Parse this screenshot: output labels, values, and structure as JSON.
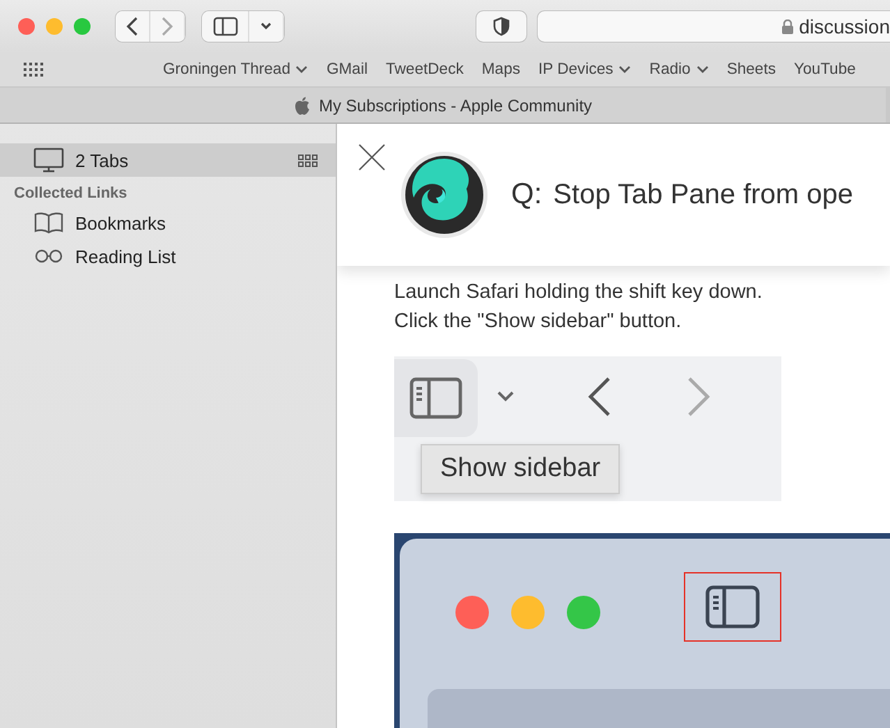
{
  "toolbar": {
    "address": "discussion"
  },
  "bookmarks": [
    {
      "label": "Groningen Thread",
      "menu": true
    },
    {
      "label": "GMail",
      "menu": false
    },
    {
      "label": "TweetDeck",
      "menu": false
    },
    {
      "label": "Maps",
      "menu": false
    },
    {
      "label": "IP Devices",
      "menu": true
    },
    {
      "label": "Radio",
      "menu": true
    },
    {
      "label": "Sheets",
      "menu": false
    },
    {
      "label": "YouTube",
      "menu": false
    }
  ],
  "tab": {
    "title": "My Subscriptions - Apple Community"
  },
  "sidebar": {
    "tabs_item": {
      "label": "2 Tabs",
      "selected": true
    },
    "section": "Collected Links",
    "items": [
      {
        "kind": "book",
        "label": "Bookmarks"
      },
      {
        "kind": "glasses",
        "label": "Reading List"
      }
    ]
  },
  "question": {
    "prefix": "Q:",
    "title": "Stop Tab Pane from ope"
  },
  "answer": {
    "lines": [
      "Launch Safari holding the shift key down.",
      "Click the \"Show sidebar\" button."
    ]
  },
  "tooltip": "Show sidebar"
}
